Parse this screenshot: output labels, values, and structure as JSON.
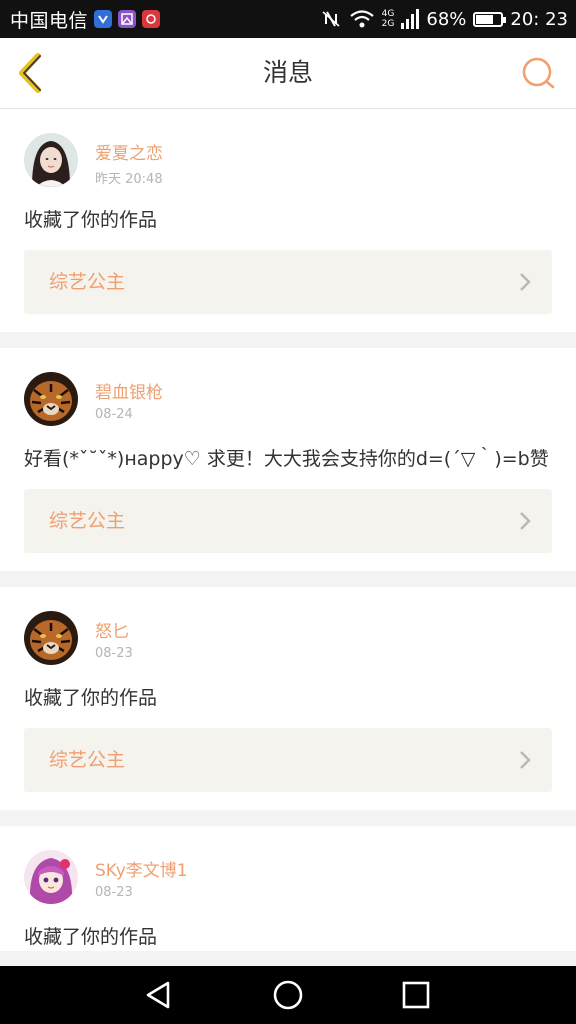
{
  "status_bar": {
    "carrier": "中国电信",
    "network_top": "4G",
    "network_bottom": "2G",
    "battery": "68%",
    "time": "20: 23",
    "battery_level": 0.68
  },
  "header": {
    "title": "消息"
  },
  "messages": [
    {
      "user": "爱夏之恋",
      "date": "昨天 20:48",
      "text": "收藏了你的作品",
      "work": "综艺公主"
    },
    {
      "user": "碧血银枪",
      "date": "08-24",
      "text": "好看(*ˇ˘ˇ*)нappy♡ 求更！大大我会支持你的d=(´▽｀)=b赞",
      "work": "综艺公主"
    },
    {
      "user": "怒匕",
      "date": "08-23",
      "text": "收藏了你的作品",
      "work": "综艺公主"
    },
    {
      "user": "SKy李文博1",
      "date": "08-23",
      "text": "收藏了你的作品",
      "work": ""
    }
  ],
  "colors": {
    "accent": "#f0a070",
    "back_arrow": "#e8c020",
    "work_bg": "#f4f3ee"
  },
  "icons": {
    "back": "chevron-left-icon",
    "search": "search-icon",
    "chevron": "chevron-right-icon",
    "nav_back": "triangle-back-icon",
    "nav_home": "circle-home-icon",
    "nav_recent": "square-recent-icon"
  }
}
